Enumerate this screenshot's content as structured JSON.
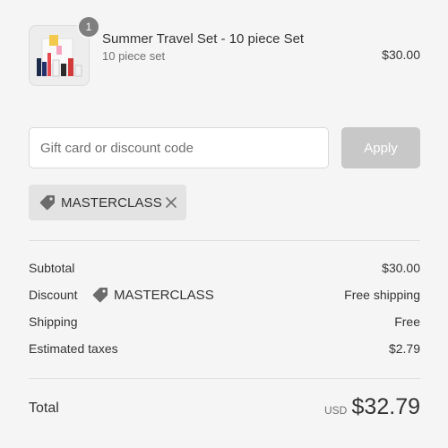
{
  "product": {
    "title": "Summer Travel Set - 10 piece Set",
    "variant": "10 piece set",
    "price": "$30.00",
    "quantity": "1"
  },
  "discount_form": {
    "placeholder": "Gift card or discount code",
    "value": "",
    "apply_label": "Apply"
  },
  "applied_code": {
    "code": "MASTERCLASS",
    "icon": "tag-icon",
    "remove_icon": "close-icon"
  },
  "summary": {
    "subtotal_label": "Subtotal",
    "subtotal_value": "$30.00",
    "discount_label": "Discount",
    "discount_code": "MASTERCLASS",
    "discount_value": "Free shipping",
    "shipping_label": "Shipping",
    "shipping_value": "Free",
    "taxes_label": "Estimated taxes",
    "taxes_value": "$2.79"
  },
  "total": {
    "label": "Total",
    "currency": "USD",
    "amount": "$32.79"
  },
  "colors": {
    "background": "#f5f5f5",
    "apply_disabled": "#c8c8c8",
    "chip_background": "#e3e3e3",
    "badge": "#7f7f7f"
  }
}
